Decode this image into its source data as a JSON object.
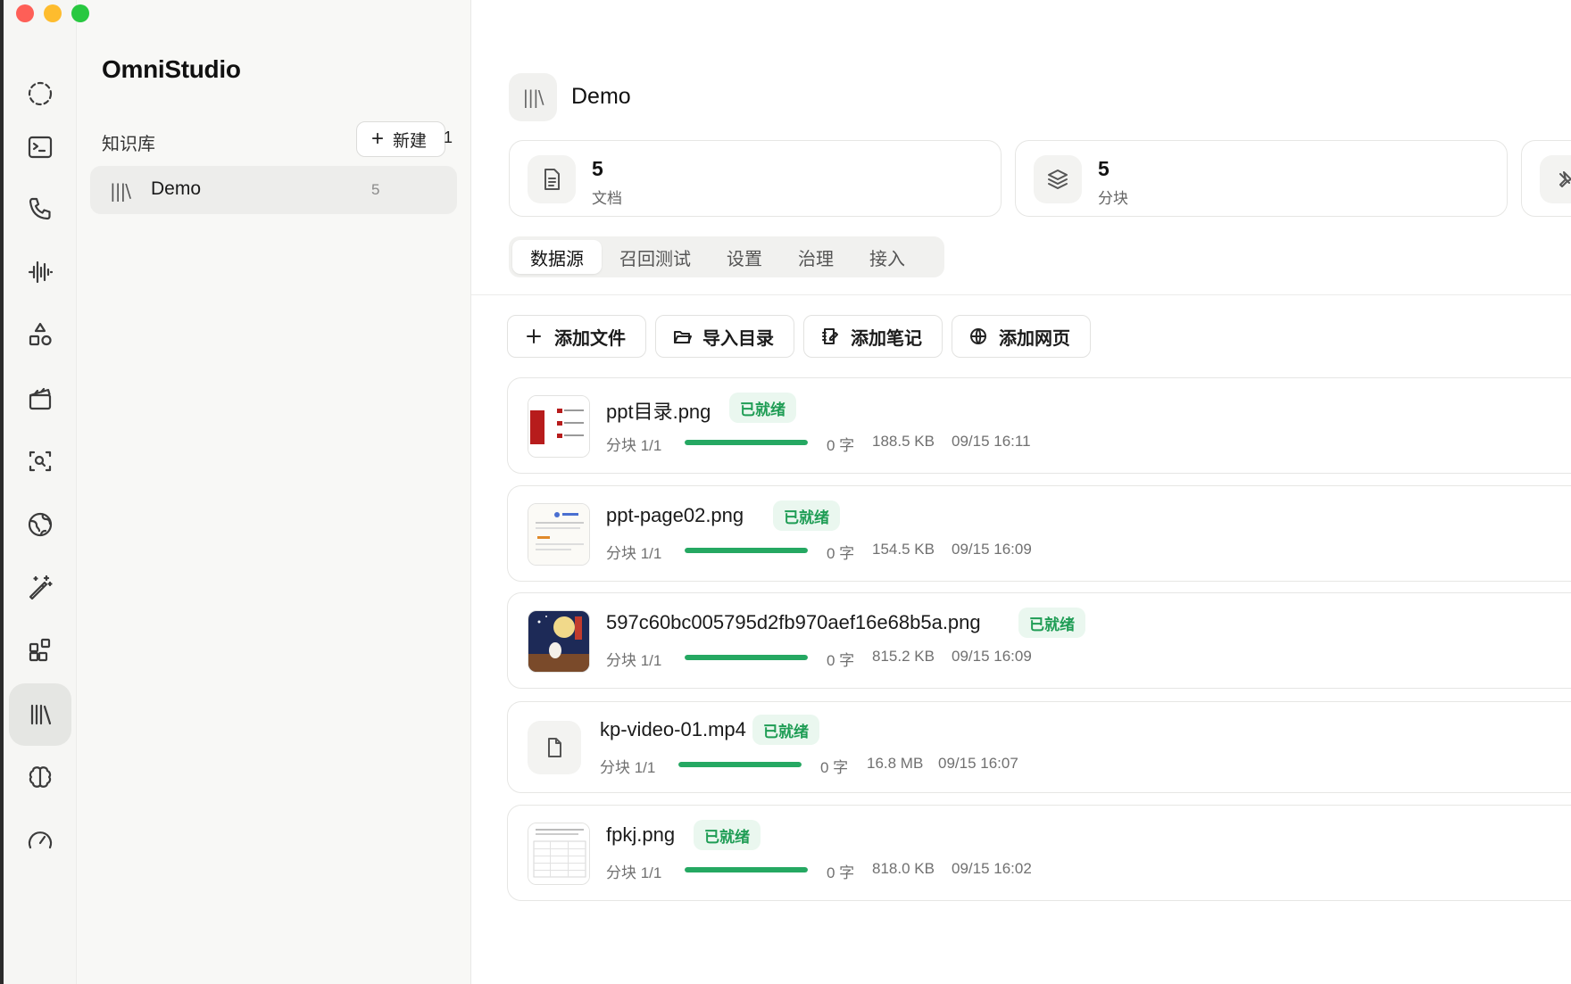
{
  "app": {
    "title": "OmniStudio"
  },
  "sidebar": {
    "section_label": "知识库",
    "new_button_label": "新建",
    "new_badge": "1",
    "items": [
      {
        "name": "Demo",
        "count": "5"
      }
    ]
  },
  "main": {
    "title": "Demo",
    "stats": [
      {
        "value": "5",
        "label": "文档",
        "icon": "document-icon"
      },
      {
        "value": "5",
        "label": "分块",
        "icon": "layers-icon"
      }
    ],
    "tabs": [
      "数据源",
      "召回测试",
      "设置",
      "治理",
      "接入"
    ],
    "actions": [
      "添加文件",
      "导入目录",
      "添加笔记",
      "添加网页"
    ],
    "files": [
      {
        "name": "ppt目录.png",
        "status": "已就绪",
        "chunks": "分块 1/1",
        "progress": 1.0,
        "chars": "0 字",
        "size": "188.5 KB",
        "time": "09/15 16:11",
        "kind": "image"
      },
      {
        "name": "ppt-page02.png",
        "status": "已就绪",
        "chunks": "分块 1/1",
        "progress": 1.0,
        "chars": "0 字",
        "size": "154.5 KB",
        "time": "09/15 16:09",
        "kind": "image"
      },
      {
        "name": "597c60bc005795d2fb970aef16e68b5a.png",
        "status": "已就绪",
        "chunks": "分块 1/1",
        "progress": 1.0,
        "chars": "0 字",
        "size": "815.2 KB",
        "time": "09/15 16:09",
        "kind": "image"
      },
      {
        "name": "kp-video-01.mp4",
        "status": "已就绪",
        "chunks": "分块 1/1",
        "progress": 1.0,
        "chars": "0 字",
        "size": "16.8 MB",
        "time": "09/15 16:07",
        "kind": "file"
      },
      {
        "name": "fpkj.png",
        "status": "已就绪",
        "chunks": "分块 1/1",
        "progress": 1.0,
        "chars": "0 字",
        "size": "818.0 KB",
        "time": "09/15 16:02",
        "kind": "image"
      }
    ]
  },
  "colors": {
    "accent_green": "#25a862",
    "badge_bg": "#eaf7ef",
    "badge_text": "#1f9d55"
  }
}
